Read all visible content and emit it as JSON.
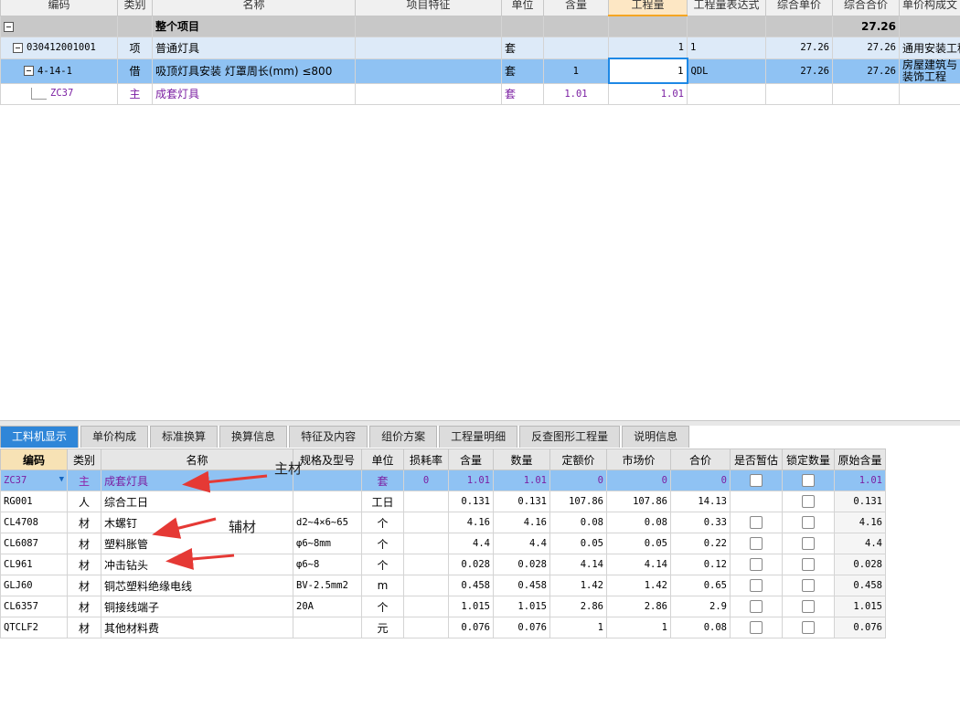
{
  "top_grid": {
    "headers": [
      "编码",
      "类别",
      "名称",
      "项目特征",
      "单位",
      "含量",
      "工程量",
      "工程量表达式",
      "综合单价",
      "综合合价",
      "单价构成文"
    ],
    "total_row": {
      "name": "整个项目",
      "total": "27.26"
    },
    "item_row": {
      "code": "030412001001",
      "type": "项",
      "name": "普通灯具",
      "unit": "套",
      "qty": "1",
      "expr": "1",
      "unit_price": "27.26",
      "total": "27.26",
      "composition": "通用安装工程"
    },
    "quota_row": {
      "code": "4-14-1",
      "type": "借",
      "name": "吸顶灯具安装 灯罩周长(mm) ≤800",
      "unit": "套",
      "content": "1",
      "qty": "1",
      "expr": "QDL",
      "unit_price": "27.26",
      "total": "27.26",
      "composition": "房屋建筑与装饰工程"
    },
    "main_row": {
      "code": "ZC37",
      "type": "主",
      "name": "成套灯具",
      "unit": "套",
      "content": "1.01",
      "qty": "1.01"
    }
  },
  "tabs": [
    "工料机显示",
    "单价构成",
    "标准换算",
    "换算信息",
    "特征及内容",
    "组价方案",
    "工程量明细",
    "反查图形工程量",
    "说明信息"
  ],
  "bottom_grid": {
    "headers": [
      "编码",
      "类别",
      "名称",
      "规格及型号",
      "单位",
      "损耗率",
      "含量",
      "数量",
      "定额价",
      "市场价",
      "合价",
      "是否暂估",
      "锁定数量",
      "原始含量"
    ],
    "rows": [
      {
        "code": "ZC37",
        "type": "主",
        "name": "成套灯具",
        "spec": "",
        "unit": "套",
        "loss": "0",
        "content": "1.01",
        "qty": "1.01",
        "quota_price": "0",
        "market_price": "0",
        "total": "0",
        "orig": "1.01"
      },
      {
        "code": "RG001",
        "type": "人",
        "name": "综合工日",
        "spec": "",
        "unit": "工日",
        "loss": "",
        "content": "0.131",
        "qty": "0.131",
        "quota_price": "107.86",
        "market_price": "107.86",
        "total": "14.13",
        "orig": "0.131"
      },
      {
        "code": "CL4708",
        "type": "材",
        "name": "木螺钉",
        "spec": "d2~4×6~65",
        "unit": "个",
        "loss": "",
        "content": "4.16",
        "qty": "4.16",
        "quota_price": "0.08",
        "market_price": "0.08",
        "total": "0.33",
        "orig": "4.16"
      },
      {
        "code": "CL6087",
        "type": "材",
        "name": "塑料胀管",
        "spec": "φ6~8mm",
        "unit": "个",
        "loss": "",
        "content": "4.4",
        "qty": "4.4",
        "quota_price": "0.05",
        "market_price": "0.05",
        "total": "0.22",
        "orig": "4.4"
      },
      {
        "code": "CL961",
        "type": "材",
        "name": "冲击钻头",
        "spec": "φ6~8",
        "unit": "个",
        "loss": "",
        "content": "0.028",
        "qty": "0.028",
        "quota_price": "4.14",
        "market_price": "4.14",
        "total": "0.12",
        "orig": "0.028"
      },
      {
        "code": "GLJ60",
        "type": "材",
        "name": "铜芯塑料绝缘电线",
        "spec": "BV-2.5mm2",
        "unit": "m",
        "loss": "",
        "content": "0.458",
        "qty": "0.458",
        "quota_price": "1.42",
        "market_price": "1.42",
        "total": "0.65",
        "orig": "0.458"
      },
      {
        "code": "CL6357",
        "type": "材",
        "name": "铜接线端子",
        "spec": "20A",
        "unit": "个",
        "loss": "",
        "content": "1.015",
        "qty": "1.015",
        "quota_price": "2.86",
        "market_price": "2.86",
        "total": "2.9",
        "orig": "1.015"
      },
      {
        "code": "QTCLF2",
        "type": "材",
        "name": "其他材料费",
        "spec": "",
        "unit": "元",
        "loss": "",
        "content": "0.076",
        "qty": "0.076",
        "quota_price": "1",
        "market_price": "1",
        "total": "0.08",
        "orig": "0.076"
      }
    ]
  },
  "annotations": {
    "main_material": "主材",
    "aux_material": "辅材"
  },
  "colors": {
    "selected_row": "#8fc2f3",
    "active_tab": "#2f86d8",
    "main_material_text": "#7b1fa2",
    "arrow": "#e53935"
  }
}
